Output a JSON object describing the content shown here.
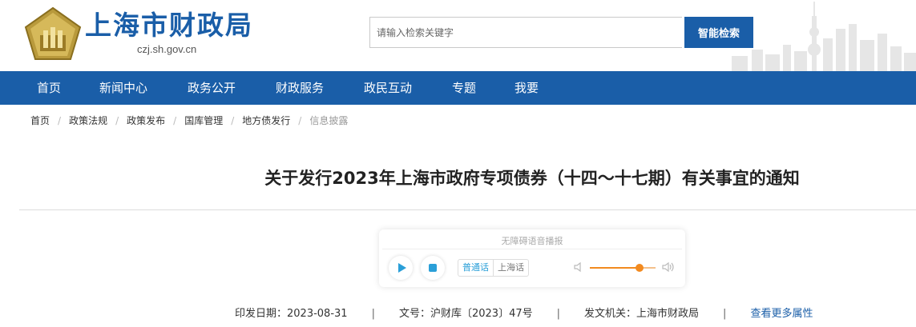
{
  "header": {
    "site_title": "上海市财政局",
    "site_domain": "czj.sh.gov.cn",
    "search_placeholder": "请输入检索关键字",
    "search_button": "智能检索"
  },
  "nav": {
    "items": [
      {
        "label": "首页"
      },
      {
        "label": "新闻中心"
      },
      {
        "label": "政务公开"
      },
      {
        "label": "财政服务"
      },
      {
        "label": "政民互动"
      },
      {
        "label": "专题"
      },
      {
        "label": "我要"
      }
    ]
  },
  "breadcrumb": [
    "首页",
    "政策法规",
    "政策发布",
    "国库管理",
    "地方债发行",
    "信息披露"
  ],
  "article": {
    "title": "关于发行2023年上海市政府专项债券（十四～十七期）有关事宜的通知"
  },
  "player": {
    "title": "无障碍语音播报",
    "lang_active": "普通话",
    "lang_inactive": "上海话",
    "volume": 0.75,
    "accent": "#2a9fd8",
    "volume_color": "#f28a1f"
  },
  "meta": {
    "date_label": "印发日期：",
    "date": "2023-08-31",
    "doc_no_label": "文号：",
    "doc_no": "沪财库〔2023〕47号",
    "issuer_label": "发文机关：",
    "issuer": "上海市财政局",
    "more_link": "查看更多属性"
  },
  "colors": {
    "brand": "#1a5ea8"
  }
}
